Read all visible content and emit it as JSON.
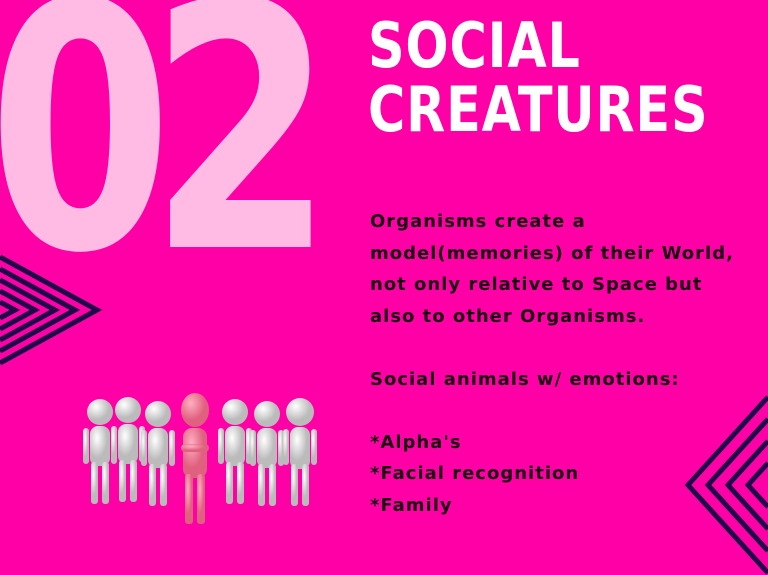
{
  "slide": {
    "number": "02",
    "title_lines": [
      "SOCIAL",
      "CREATURES"
    ],
    "paragraph_lines": [
      "Organisms create a",
      "model(memories) of their World,",
      "not only relative to Space but",
      "also to other Organisms."
    ],
    "subheading": "Social animals w/ emotions:",
    "bullets": [
      "*Alpha's",
      "*Facial recognition",
      "*Family"
    ]
  },
  "colors": {
    "background": "#ff00a6",
    "number": "#ffc6e8",
    "title": "#ffffff",
    "text": "#1a0010",
    "chevrons": "#1e0a4a"
  }
}
